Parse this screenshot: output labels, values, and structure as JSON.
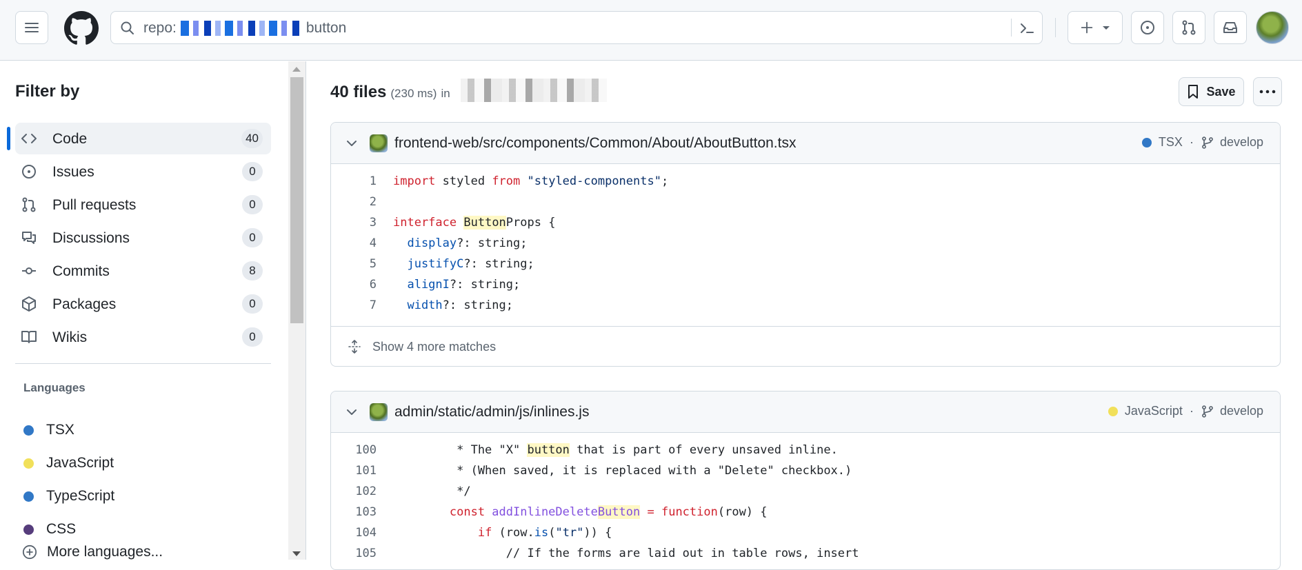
{
  "header": {
    "search_prefix": "repo:",
    "search_suffix": "button"
  },
  "sidebar": {
    "title": "Filter by",
    "filters": [
      {
        "label": "Code",
        "count": "40",
        "icon": "code-icon"
      },
      {
        "label": "Issues",
        "count": "0",
        "icon": "issue-icon"
      },
      {
        "label": "Pull requests",
        "count": "0",
        "icon": "pull-request-icon"
      },
      {
        "label": "Discussions",
        "count": "0",
        "icon": "discussion-icon"
      },
      {
        "label": "Commits",
        "count": "8",
        "icon": "commit-icon"
      },
      {
        "label": "Packages",
        "count": "0",
        "icon": "package-icon"
      },
      {
        "label": "Wikis",
        "count": "0",
        "icon": "book-icon"
      }
    ],
    "languages_heading": "Languages",
    "languages": [
      {
        "name": "TSX",
        "color": "#3178c6"
      },
      {
        "name": "JavaScript",
        "color": "#f1e05a"
      },
      {
        "name": "TypeScript",
        "color": "#3178c6"
      },
      {
        "name": "CSS",
        "color": "#563d7c"
      }
    ],
    "more_languages": "More languages..."
  },
  "results": {
    "count": "40 files",
    "time": "(230 ms)",
    "in_label": "in",
    "save_label": "Save"
  },
  "cards": [
    {
      "path": "frontend-web/src/components/Common/About/AboutButton.tsx",
      "language": "TSX",
      "language_color": "#3178c6",
      "branch": "develop",
      "footer": "Show 4 more matches",
      "lines": [
        {
          "n": "1"
        },
        {
          "n": "2"
        },
        {
          "n": "3"
        },
        {
          "n": "4"
        },
        {
          "n": "5"
        },
        {
          "n": "6"
        },
        {
          "n": "7"
        }
      ]
    },
    {
      "path": "admin/static/admin/js/inlines.js",
      "language": "JavaScript",
      "language_color": "#f1e05a",
      "branch": "develop",
      "lines": [
        {
          "n": "100"
        },
        {
          "n": "101"
        },
        {
          "n": "102"
        },
        {
          "n": "103"
        },
        {
          "n": "104"
        },
        {
          "n": "105"
        }
      ]
    }
  ],
  "code": {
    "c1l1_a": "import",
    "c1l1_b": " styled ",
    "c1l1_c": "from",
    "c1l1_d": " \"styled-components\"",
    "c1l1_e": ";",
    "c1l3_a": "interface",
    "c1l3_b": " ",
    "c1l3_c": "Button",
    "c1l3_d": "Props {",
    "c1l4_a": "  display",
    "c1l4_b": "?: string;",
    "c1l5_a": "  justifyC",
    "c1l5_b": "?: string;",
    "c1l6_a": "  alignI",
    "c1l6_b": "?: string;",
    "c1l7_a": "  width",
    "c1l7_b": "?: string;",
    "c2l100_a": "         * The \"X\" ",
    "c2l100_b": "button",
    "c2l100_c": " that is part of every unsaved inline.",
    "c2l101": "         * (When saved, it is replaced with a \"Delete\" checkbox.)",
    "c2l102": "         */",
    "c2l103_a": "        const ",
    "c2l103_b": "addInlineDelete",
    "c2l103_c": "Button",
    "c2l103_d": " = ",
    "c2l103_e": "function",
    "c2l103_f": "(row) {",
    "c2l104_a": "            ",
    "c2l104_b": "if",
    "c2l104_c": " (row.",
    "c2l104_d": "is",
    "c2l104_e": "(",
    "c2l104_f": "\"tr\"",
    "c2l104_g": ")) {",
    "c2l105": "                // If the forms are laid out in table rows, insert"
  }
}
